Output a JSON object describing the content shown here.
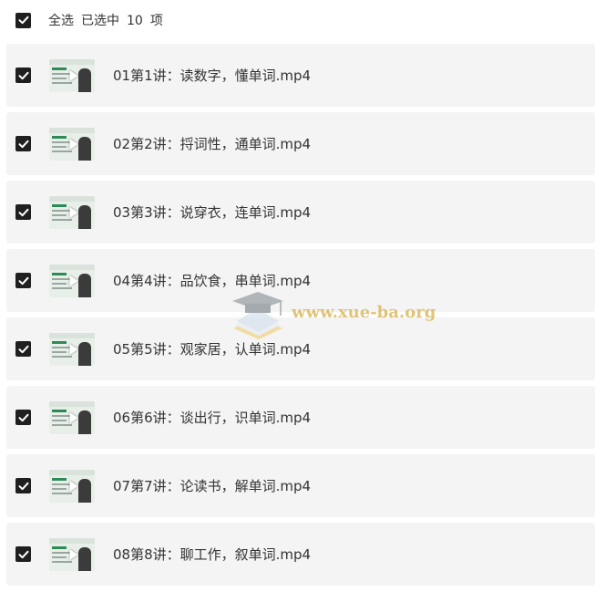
{
  "header": {
    "select_all_label": "全选",
    "selected_prefix": "已选中",
    "selected_count": "10",
    "selected_unit": "项",
    "select_all_checked": true
  },
  "items": [
    {
      "title": "01第1讲：读数字，懂单词.mp4",
      "checked": true,
      "thumb_icon": "video-thumbnail"
    },
    {
      "title": "02第2讲：捋词性，通单词.mp4",
      "checked": true,
      "thumb_icon": "video-thumbnail"
    },
    {
      "title": "03第3讲：说穿衣，连单词.mp4",
      "checked": true,
      "thumb_icon": "video-thumbnail"
    },
    {
      "title": "04第4讲：品饮食，串单词.mp4",
      "checked": true,
      "thumb_icon": "video-thumbnail"
    },
    {
      "title": "05第5讲：观家居，认单词.mp4",
      "checked": true,
      "thumb_icon": "video-thumbnail"
    },
    {
      "title": "06第6讲：谈出行，识单词.mp4",
      "checked": true,
      "thumb_icon": "video-thumbnail"
    },
    {
      "title": "07第7讲：论读书，解单词.mp4",
      "checked": true,
      "thumb_icon": "video-thumbnail"
    },
    {
      "title": "08第8讲：聊工作，叙单词.mp4",
      "checked": true,
      "thumb_icon": "video-thumbnail"
    }
  ],
  "watermark": {
    "text": "www.xue-ba.org",
    "icon": "graduation-cap-icon"
  },
  "colors": {
    "checkbox": "#1f1f1f",
    "row_background": "#f4f4f4",
    "text": "#333333",
    "watermark": "#d9b04a"
  }
}
